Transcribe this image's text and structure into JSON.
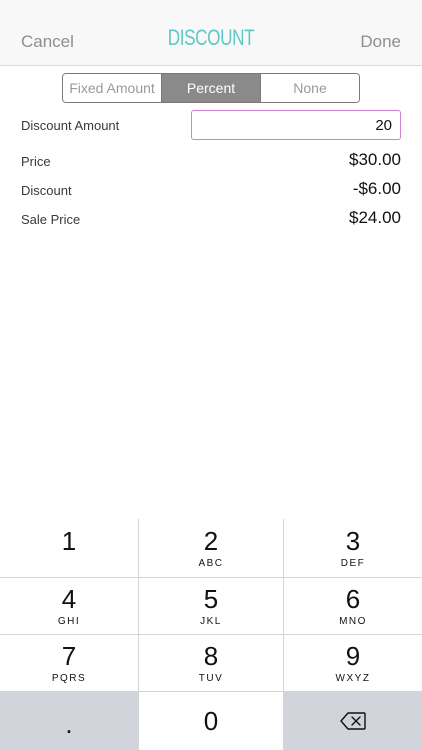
{
  "nav": {
    "cancel": "Cancel",
    "title": "DISCOUNT",
    "done": "Done"
  },
  "segments": [
    {
      "label": "Fixed Amount",
      "selected": false
    },
    {
      "label": "Percent",
      "selected": true
    },
    {
      "label": "None",
      "selected": false
    }
  ],
  "form": {
    "discount_amount_label": "Discount Amount",
    "discount_amount_value": "20",
    "price_label": "Price",
    "price_value": "$30.00",
    "discount_label": "Discount",
    "discount_value": "-$6.00",
    "sale_price_label": "Sale Price",
    "sale_price_value": "$24.00"
  },
  "keypad": {
    "keys": [
      {
        "num": "1",
        "letters": ""
      },
      {
        "num": "2",
        "letters": "ABC"
      },
      {
        "num": "3",
        "letters": "DEF"
      },
      {
        "num": "4",
        "letters": "GHI"
      },
      {
        "num": "5",
        "letters": "JKL"
      },
      {
        "num": "6",
        "letters": "MNO"
      },
      {
        "num": "7",
        "letters": "PQRS"
      },
      {
        "num": "8",
        "letters": "TUV"
      },
      {
        "num": "9",
        "letters": "WXYZ"
      }
    ],
    "dot": ".",
    "zero": "0",
    "delete_icon": "backspace-icon"
  },
  "colors": {
    "title_accent": "#5ec7c7",
    "input_border": "#d37fd3",
    "segment_active": "#8a8a8a",
    "keypad_gray": "#d1d4da"
  }
}
